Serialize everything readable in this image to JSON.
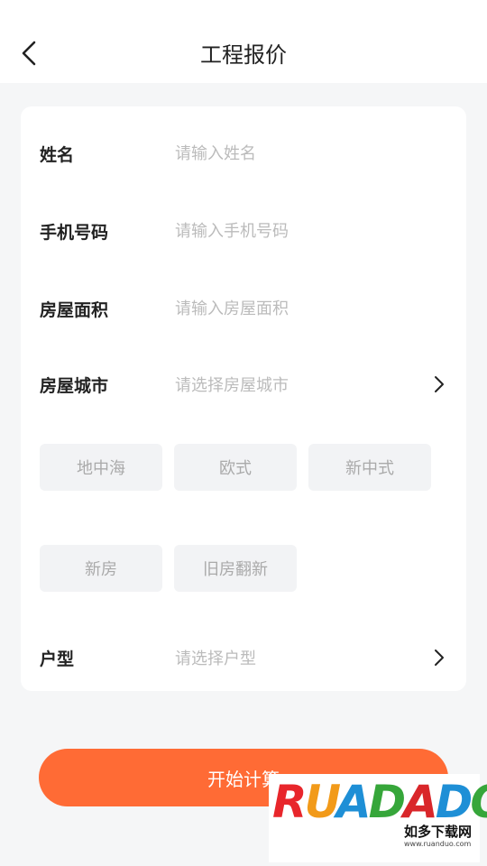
{
  "header": {
    "title": "工程报价"
  },
  "form": {
    "name": {
      "label": "姓名",
      "placeholder": "请输入姓名"
    },
    "phone": {
      "label": "手机号码",
      "placeholder": "请输入手机号码"
    },
    "area": {
      "label": "房屋面积",
      "placeholder": "请输入房屋面积"
    },
    "city": {
      "label": "房屋城市",
      "placeholder": "请选择房屋城市"
    },
    "styles": [
      "地中海",
      "欧式",
      "新中式"
    ],
    "house_types": [
      "新房",
      "旧房翻新"
    ],
    "layout": {
      "label": "户型",
      "placeholder": "请选择户型"
    }
  },
  "start_button": {
    "label": "开始计算"
  },
  "watermark": {
    "logo": "RUANDUO",
    "sub": "如多下载网",
    "url": "www.ruanduo.com"
  },
  "colors": {
    "accent": "#ff6b35"
  }
}
